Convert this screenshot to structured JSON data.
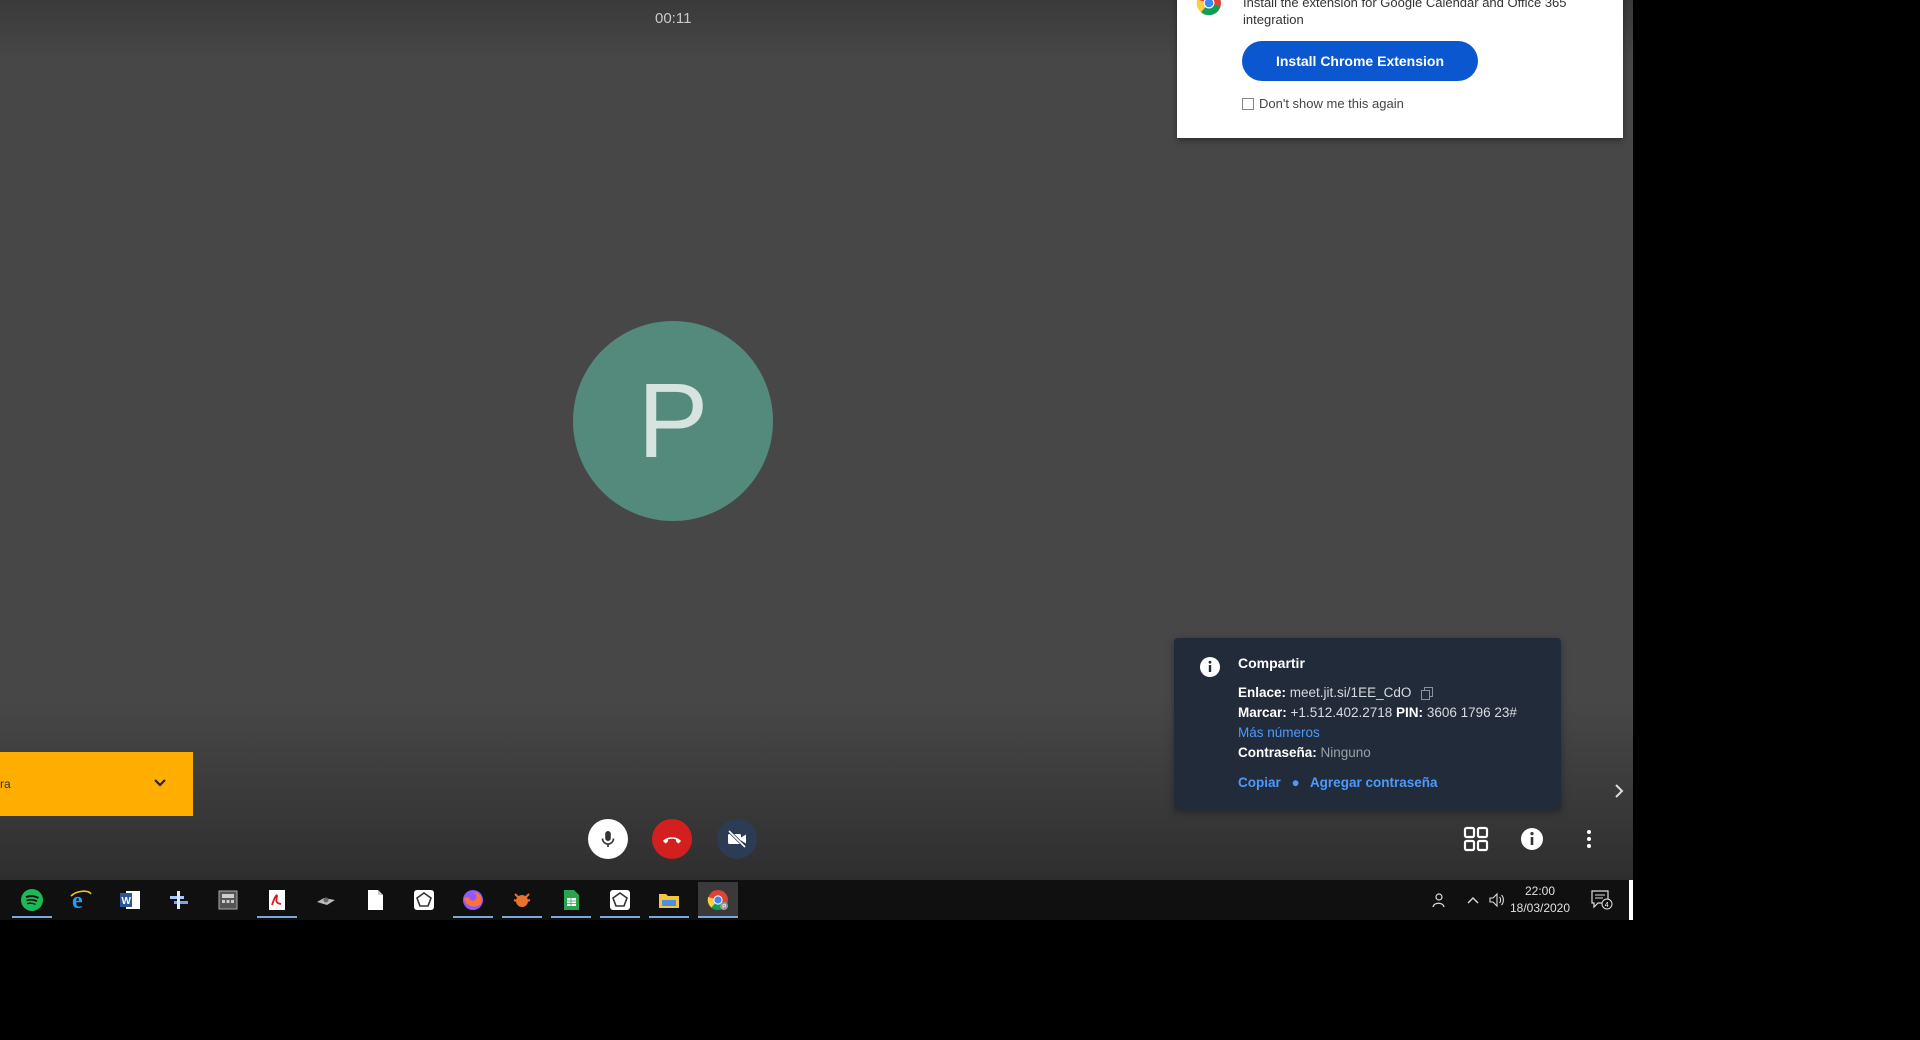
{
  "call": {
    "timer": "00:11",
    "avatar_letter": "P"
  },
  "extension_popup": {
    "text": "Install the extension for Google Calendar and Office 365 integration",
    "install_label": "Install Chrome Extension",
    "dont_show_label": "Don't show me this again"
  },
  "yellow_banner": {
    "text": "ra"
  },
  "share": {
    "title": "Compartir",
    "link_label": "Enlace:",
    "link_value": "meet.jit.si/1EE_CdO",
    "dial_label": "Marcar:",
    "dial_value": "+1.512.402.2718",
    "pin_label": "PIN:",
    "pin_value": "3606 1796 23#",
    "more_numbers": "Más números",
    "password_label": "Contraseña:",
    "password_value": "Ninguno",
    "copy_action": "Copiar",
    "add_password_action": "Agregar contraseña"
  },
  "taskbar": {
    "apps": [
      "spotify-icon",
      "internet-explorer-icon",
      "word-icon",
      "slack-like-icon",
      "calculator-icon",
      "acrobat-icon",
      "game-icon",
      "notepad-icon",
      "pentagon-app-icon",
      "firefox-icon",
      "tarantula-icon",
      "spreadsheet-icon",
      "pentagon-app-2-icon",
      "file-explorer-icon",
      "chrome-icon"
    ],
    "clock_time": "22:00",
    "clock_date": "18/03/2020",
    "notification_count": "4"
  },
  "colors": {
    "avatar_bg": "#538a7b",
    "install_button": "#0b57d0",
    "hangup": "#d3201f",
    "banner": "#ffae00",
    "share_panel": "#222b39",
    "link": "#4c9aff"
  }
}
